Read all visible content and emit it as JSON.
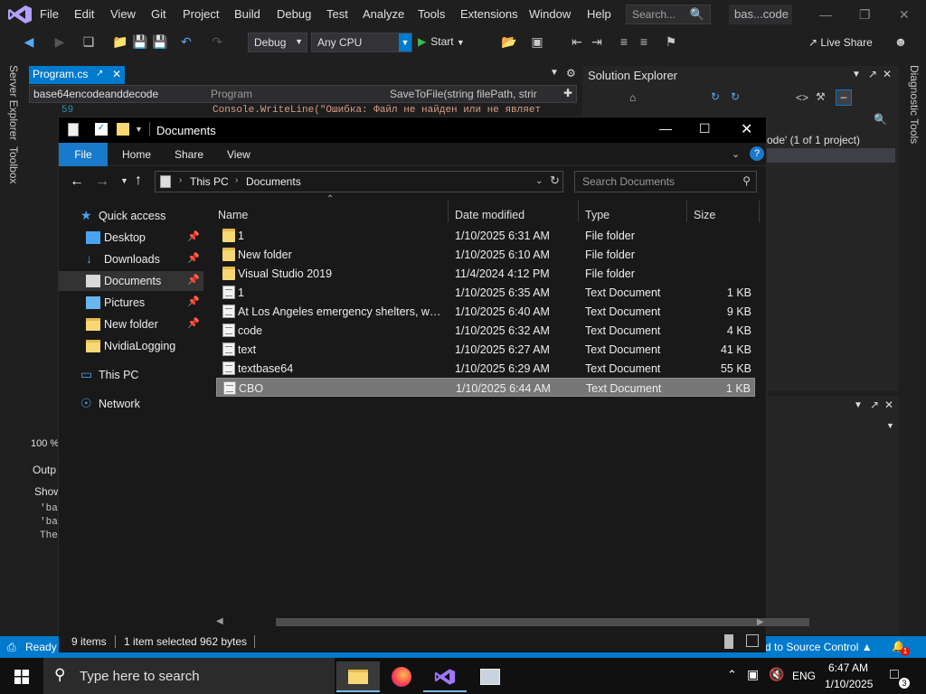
{
  "vs": {
    "menu": [
      "File",
      "Edit",
      "View",
      "Git",
      "Project",
      "Build",
      "Debug",
      "Test",
      "Analyze",
      "Tools",
      "Extensions",
      "Window",
      "Help"
    ],
    "search_placeholder": "Search...",
    "title_badge": "bas...code",
    "config": "Debug",
    "platform": "Any CPU",
    "start_label": "Start",
    "live_share": "Live Share",
    "left_tools": [
      "Server Explorer",
      "Toolbox"
    ],
    "right_tools": [
      "Diagnostic Tools"
    ],
    "doc_tab": "Program.cs",
    "nav_project": "base64encodeanddecode",
    "nav_class": "Program",
    "nav_member": "SaveToFile(string filePath, strir",
    "line_number": "59",
    "code_line": "Console.WriteLine(\"Ошибка: Файл не найден или не являет",
    "solution_explorer_title": "Solution Explorer",
    "solution_text": "ode' (1 of 1 project)",
    "zoom": "100 %",
    "output_title": "Outp",
    "output_show": "Show",
    "output_lines": [
      "'ba",
      "'ba",
      "The"
    ],
    "status_ready": "Ready",
    "status_source_control": "d to Source Control",
    "notification_count": "1"
  },
  "explorer": {
    "title": "Documents",
    "ribbon_tabs": [
      "File",
      "Home",
      "Share",
      "View"
    ],
    "breadcrumb": [
      "This PC",
      "Documents"
    ],
    "search_placeholder": "Search Documents",
    "columns": {
      "name": "Name",
      "date": "Date modified",
      "type": "Type",
      "size": "Size"
    },
    "nav": [
      {
        "label": "Quick access",
        "icon": "star-icon",
        "pin": false
      },
      {
        "label": "Desktop",
        "icon": "desktop-icon",
        "pin": true
      },
      {
        "label": "Downloads",
        "icon": "download-icon",
        "pin": true
      },
      {
        "label": "Documents",
        "icon": "documents-icon",
        "pin": true,
        "selected": true
      },
      {
        "label": "Pictures",
        "icon": "pictures-icon",
        "pin": true
      },
      {
        "label": "New folder",
        "icon": "folder-icon",
        "pin": true
      },
      {
        "label": "NvidiaLogging",
        "icon": "folder-icon",
        "pin": false
      },
      {
        "label": "This PC",
        "icon": "computer-icon",
        "pin": false
      },
      {
        "label": "Network",
        "icon": "network-icon",
        "pin": false
      }
    ],
    "files": [
      {
        "name": "1",
        "date": "1/10/2025 6:31 AM",
        "type": "File folder",
        "size": "",
        "kind": "folder"
      },
      {
        "name": "New folder",
        "date": "1/10/2025 6:10 AM",
        "type": "File folder",
        "size": "",
        "kind": "folder"
      },
      {
        "name": "Visual Studio 2019",
        "date": "11/4/2024 4:12 PM",
        "type": "File folder",
        "size": "",
        "kind": "folder"
      },
      {
        "name": "1",
        "date": "1/10/2025 6:35 AM",
        "type": "Text Document",
        "size": "1 KB",
        "kind": "doc"
      },
      {
        "name": "At Los Angeles emergency shelters, wildf...",
        "date": "1/10/2025 6:40 AM",
        "type": "Text Document",
        "size": "9 KB",
        "kind": "doc"
      },
      {
        "name": "code",
        "date": "1/10/2025 6:32 AM",
        "type": "Text Document",
        "size": "4 KB",
        "kind": "doc"
      },
      {
        "name": "text",
        "date": "1/10/2025 6:27 AM",
        "type": "Text Document",
        "size": "41 KB",
        "kind": "doc"
      },
      {
        "name": "textbase64",
        "date": "1/10/2025 6:29 AM",
        "type": "Text Document",
        "size": "55 KB",
        "kind": "doc"
      },
      {
        "name": "CBO",
        "date": "1/10/2025 6:44 AM",
        "type": "Text Document",
        "size": "1 KB",
        "kind": "doc",
        "selected": true
      }
    ],
    "status_items": "9 items",
    "status_selected": "1 item selected",
    "status_size": "962 bytes"
  },
  "taskbar": {
    "search_placeholder": "Type here to search",
    "lang": "ENG",
    "time": "6:47 AM",
    "date": "1/10/2025",
    "notif_count": "3"
  },
  "colors": {
    "accent": "#007acc",
    "explorer_file_tab": "#1979ca",
    "selection": "#777777",
    "folder": "#f8d775"
  }
}
